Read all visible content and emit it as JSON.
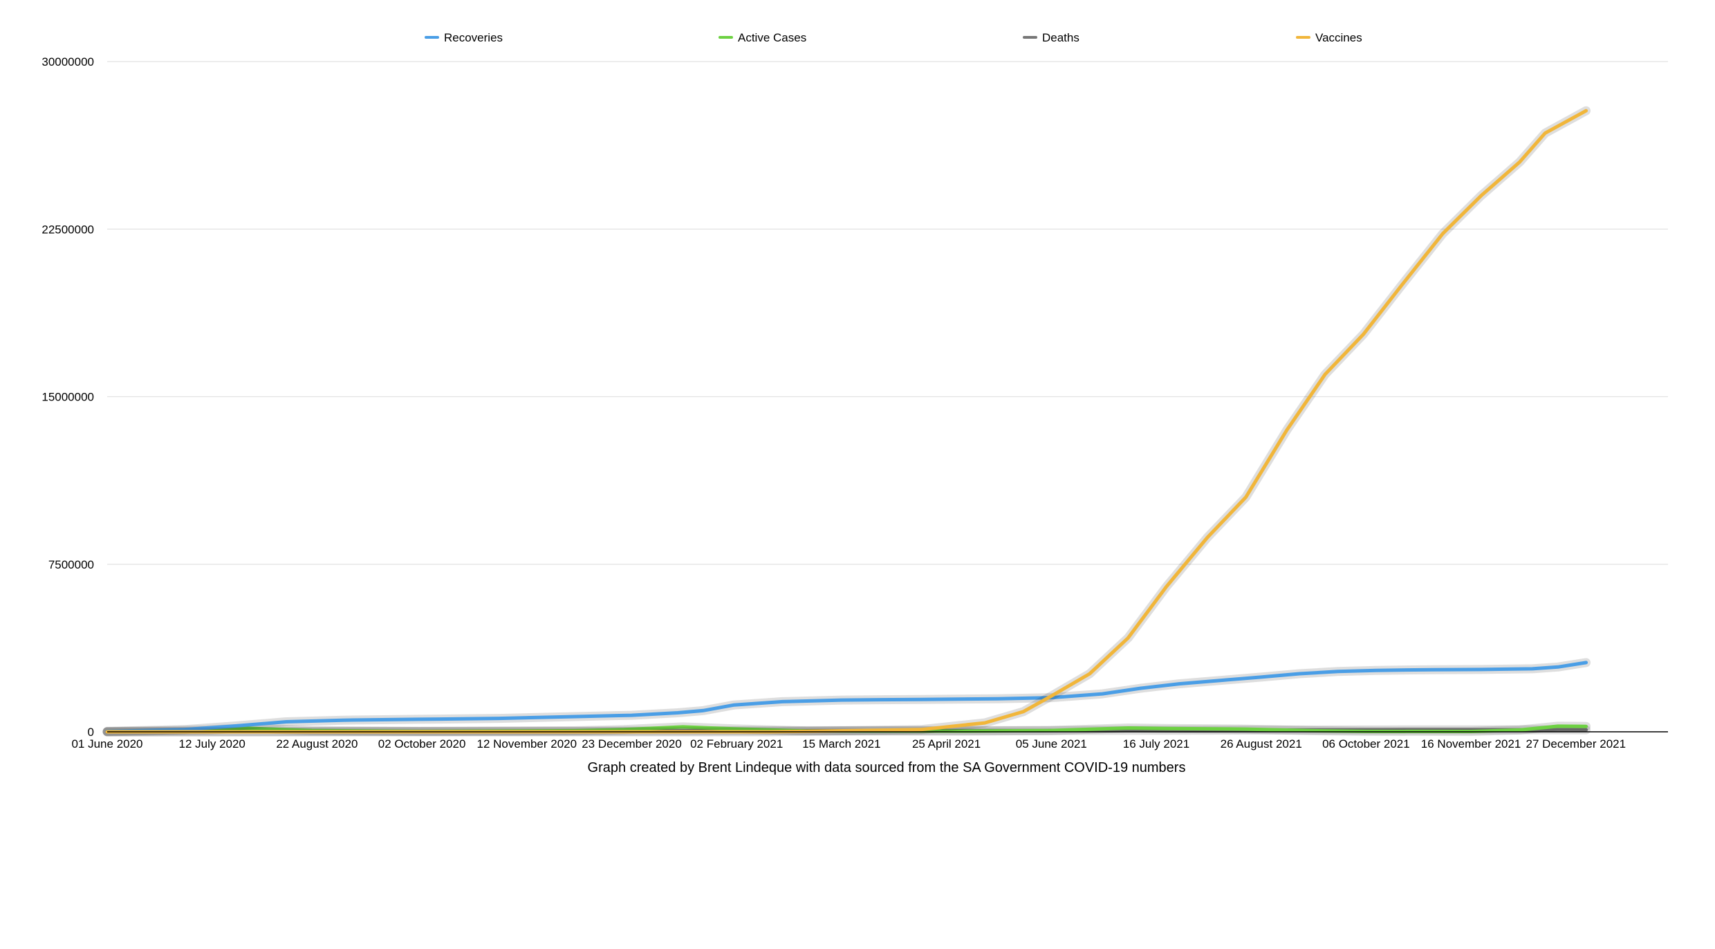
{
  "caption": "Graph created by Brent Lindeque with data sourced from the SA Government COVID-19 numbers",
  "chart_data": {
    "type": "line",
    "title": "",
    "xlabel": "",
    "ylabel": "",
    "ylim": [
      0,
      30000000
    ],
    "yticks": [
      "0",
      "7500000",
      "15000000",
      "22500000",
      "30000000"
    ],
    "xticks": [
      "01 June 2020",
      "12 July 2020",
      "22 August 2020",
      "02 October 2020",
      "12 November 2020",
      "23 December 2020",
      "02 February 2021",
      "15 March 2021",
      "25 April 2021",
      "05 June 2021",
      "16 July 2021",
      "26 August 2021",
      "06 October 2021",
      "16 November 2021",
      "27 December 2021"
    ],
    "xlim": [
      "2020-06-01",
      "2022-02-01"
    ],
    "grid": true,
    "legend_position": "top",
    "series": [
      {
        "name": "Recoveries",
        "color": "#4a9ee6",
        "x": [
          "2020-06-01",
          "2020-07-01",
          "2020-07-20",
          "2020-08-10",
          "2020-09-01",
          "2020-10-01",
          "2020-11-01",
          "2020-12-01",
          "2020-12-23",
          "2021-01-10",
          "2021-01-20",
          "2021-02-01",
          "2021-02-20",
          "2021-03-15",
          "2021-04-15",
          "2021-05-15",
          "2021-06-05",
          "2021-06-25",
          "2021-07-10",
          "2021-07-25",
          "2021-08-10",
          "2021-08-26",
          "2021-09-10",
          "2021-09-25",
          "2021-10-10",
          "2021-11-01",
          "2021-11-20",
          "2021-12-10",
          "2021-12-20",
          "2021-12-31"
        ],
        "values": [
          20000,
          100000,
          250000,
          450000,
          520000,
          560000,
          600000,
          680000,
          740000,
          850000,
          950000,
          1200000,
          1350000,
          1420000,
          1450000,
          1480000,
          1530000,
          1700000,
          1950000,
          2150000,
          2300000,
          2450000,
          2600000,
          2700000,
          2750000,
          2780000,
          2790000,
          2820000,
          2900000,
          3100000
        ]
      },
      {
        "name": "Active Cases",
        "color": "#6dd142",
        "x": [
          "2020-06-01",
          "2020-07-10",
          "2020-07-25",
          "2020-08-20",
          "2020-10-01",
          "2020-12-01",
          "2020-12-20",
          "2021-01-12",
          "2021-02-01",
          "2021-03-01",
          "2021-05-01",
          "2021-06-05",
          "2021-07-05",
          "2021-07-20",
          "2021-08-20",
          "2021-09-15",
          "2021-10-06",
          "2021-11-16",
          "2021-12-05",
          "2021-12-20",
          "2021-12-31"
        ],
        "values": [
          10000,
          80000,
          160000,
          60000,
          20000,
          50000,
          100000,
          220000,
          130000,
          40000,
          30000,
          60000,
          170000,
          150000,
          120000,
          50000,
          20000,
          15000,
          80000,
          250000,
          240000
        ]
      },
      {
        "name": "Deaths",
        "color": "#777777",
        "x": [
          "2020-06-01",
          "2020-08-01",
          "2020-10-01",
          "2020-12-01",
          "2021-01-15",
          "2021-02-15",
          "2021-04-01",
          "2021-06-01",
          "2021-07-15",
          "2021-09-01",
          "2021-10-15",
          "2021-12-01",
          "2021-12-31"
        ],
        "values": [
          1000,
          8000,
          18000,
          25000,
          40000,
          48000,
          53000,
          57000,
          65000,
          82000,
          88000,
          90000,
          91000
        ]
      },
      {
        "name": "Vaccines",
        "color": "#f1b63a",
        "x": [
          "2020-06-01",
          "2021-02-15",
          "2021-04-15",
          "2021-05-10",
          "2021-05-25",
          "2021-06-05",
          "2021-06-20",
          "2021-07-05",
          "2021-07-20",
          "2021-08-05",
          "2021-08-20",
          "2021-09-05",
          "2021-09-20",
          "2021-10-05",
          "2021-10-20",
          "2021-11-05",
          "2021-11-20",
          "2021-12-05",
          "2021-12-15",
          "2021-12-31"
        ],
        "values": [
          0,
          0,
          100000,
          400000,
          900000,
          1600000,
          2600000,
          4200000,
          6500000,
          8700000,
          10500000,
          13500000,
          16000000,
          17800000,
          20000000,
          22300000,
          24000000,
          25500000,
          26800000,
          27800000
        ]
      }
    ]
  }
}
